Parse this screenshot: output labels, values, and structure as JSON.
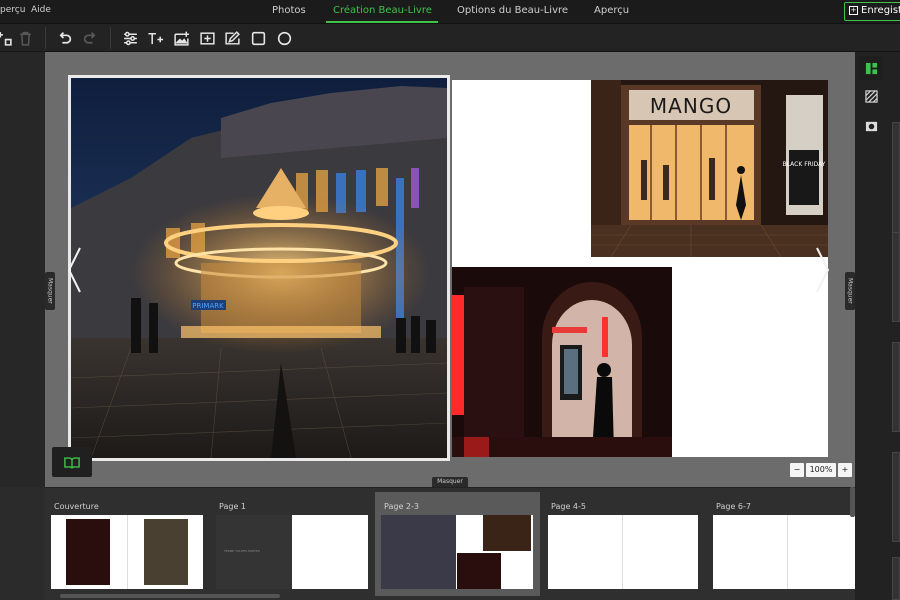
{
  "topbar": {
    "menus": [
      "perçu",
      "Aide"
    ],
    "tabs": [
      "Photos",
      "Création Beau-Livre",
      "Options du Beau-Livre",
      "Aperçu"
    ],
    "save_label": "Enregistrer"
  },
  "side_handles": {
    "left": "Masquer",
    "right": "Masquer"
  },
  "bottom_handle": "Masquer",
  "zoom": {
    "minus": "−",
    "value": "100%",
    "plus": "+"
  },
  "photos": {
    "mango_sign": "MANGO",
    "black_friday": "BLACK FRIDAY",
    "primark": "PRIMARK"
  },
  "thumbnails": [
    {
      "label": "Couverture"
    },
    {
      "label": "Page 1",
      "caption": "FERME TOUTES PORTES"
    },
    {
      "label": "Page 2-3"
    },
    {
      "label": "Page 4-5"
    },
    {
      "label": "Page 6-7"
    }
  ],
  "colors": {
    "accent": "#3ec24a"
  }
}
